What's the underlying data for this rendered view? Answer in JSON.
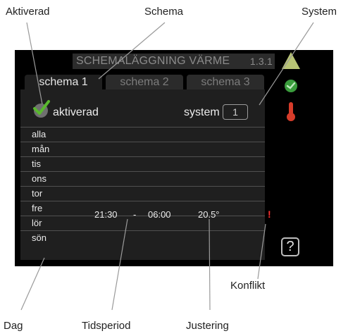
{
  "annotations": {
    "aktiverad": "Aktiverad",
    "schema": "Schema",
    "system": "System",
    "konflikt": "Konflikt",
    "dag": "Dag",
    "tidsperiod": "Tidsperiod",
    "justering": "Justering"
  },
  "screen": {
    "title": "SCHEMALÄGGNING VÄRME",
    "menu_number": "1.3.1",
    "tabs": [
      {
        "label": "schema 1",
        "active": true
      },
      {
        "label": "schema 2",
        "active": false
      },
      {
        "label": "schema 3",
        "active": false
      }
    ],
    "activated_label": "aktiverad",
    "activated_checked": true,
    "system_label": "system",
    "system_value": "1",
    "days": [
      "alla",
      "mån",
      "tis",
      "ons",
      "tor",
      "fre",
      "lör",
      "sön"
    ],
    "schedule_entry": {
      "day": "fre",
      "start": "21:30",
      "separator": "-",
      "end": "06:00",
      "adjustment": "20.5°"
    },
    "conflict_marker": "!",
    "help_symbol": "?"
  },
  "colors": {
    "screen_bg": "#000000",
    "check_green": "#59b82e",
    "conflict_red": "#ff3030",
    "thermometer_red": "#d63c2a"
  },
  "icons": {
    "check": "check-icon",
    "top_right": "triangle-warning-icon",
    "status": "green-status-icon",
    "thermometer": "thermometer-icon",
    "help": "help-icon"
  }
}
